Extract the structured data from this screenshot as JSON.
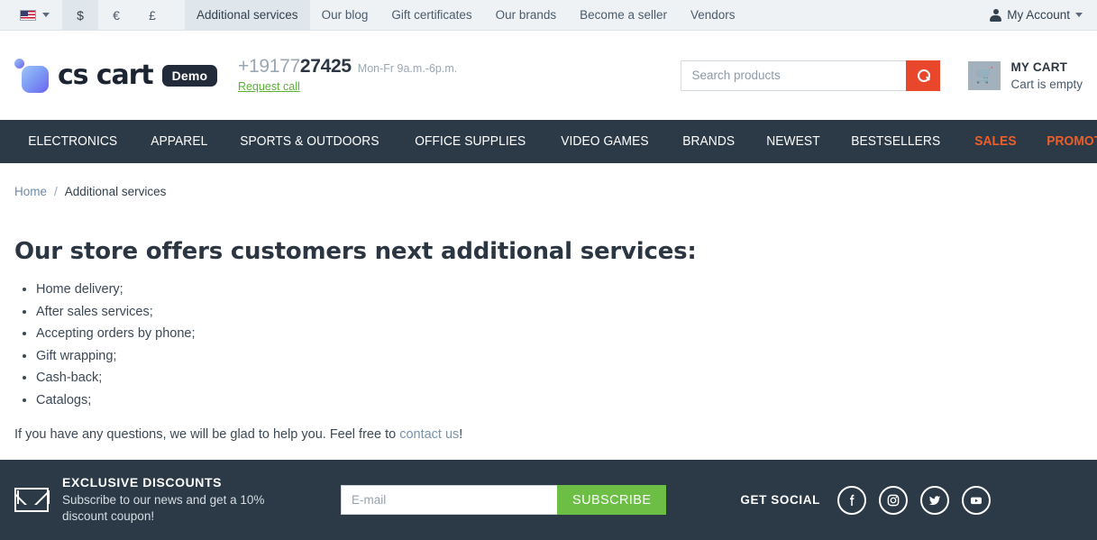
{
  "topbar": {
    "language": {
      "name": "us-flag-icon",
      "label": "English"
    },
    "currencies": [
      {
        "label": "$",
        "active": true
      },
      {
        "label": "€",
        "active": false
      },
      {
        "label": "£",
        "active": false
      }
    ],
    "links": [
      {
        "label": "Additional services",
        "active": true
      },
      {
        "label": "Our blog",
        "active": false
      },
      {
        "label": "Gift certificates",
        "active": false
      },
      {
        "label": "Our brands",
        "active": false
      },
      {
        "label": "Become a seller",
        "active": false
      },
      {
        "label": "Vendors",
        "active": false
      }
    ],
    "account_label": "My Account"
  },
  "header": {
    "logo_text": "cs cart",
    "demo_badge": "Demo",
    "phone_prefix": "+19177",
    "phone_suffix": "27425",
    "phone_hours": "Mon-Fr 9a.m.-6p.m.",
    "request_call": "Request call",
    "search_placeholder": "Search products",
    "cart_title": "MY CART",
    "cart_status": "Cart is empty"
  },
  "nav": [
    {
      "label": "ELECTRONICS",
      "highlight": false
    },
    {
      "label": "APPAREL",
      "highlight": false
    },
    {
      "label": "SPORTS & OUTDOORS",
      "highlight": false
    },
    {
      "label": "OFFICE SUPPLIES",
      "highlight": false
    },
    {
      "label": "VIDEO GAMES",
      "highlight": false
    },
    {
      "label": "BRANDS",
      "highlight": false
    },
    {
      "label": "NEWEST",
      "highlight": false
    },
    {
      "label": "BESTSELLERS",
      "highlight": false
    },
    {
      "label": "SALES",
      "highlight": true
    },
    {
      "label": "PROMOTIONS",
      "highlight": true
    }
  ],
  "breadcrumb": {
    "home": "Home",
    "separator": "/",
    "current": "Additional services"
  },
  "main": {
    "title": "Our store offers customers next additional services:",
    "services": [
      "Home delivery;",
      "After sales services;",
      "Accepting orders by phone;",
      "Gift wrapping;",
      "Cash-back;",
      "Catalogs;"
    ],
    "help_text": "If you have any questions, we will be glad to help you. Feel free to ",
    "help_link": "contact us",
    "help_tail": "!"
  },
  "footer": {
    "newsletter_title": "EXCLUSIVE DISCOUNTS",
    "newsletter_sub": "Subscribe to our news and get a 10% discount coupon!",
    "email_placeholder": "E-mail",
    "subscribe_label": "SUBSCRIBE",
    "social_label": "GET SOCIAL",
    "social": [
      {
        "name": "facebook-icon"
      },
      {
        "name": "instagram-icon"
      },
      {
        "name": "twitter-icon"
      },
      {
        "name": "youtube-icon"
      }
    ]
  },
  "colors": {
    "nav_bg": "#2c3a47",
    "accent_red": "#e8472b",
    "accent_orange": "#ec5f2b",
    "accent_green": "#6cbe45",
    "topbar_bg": "#eef2f5"
  }
}
